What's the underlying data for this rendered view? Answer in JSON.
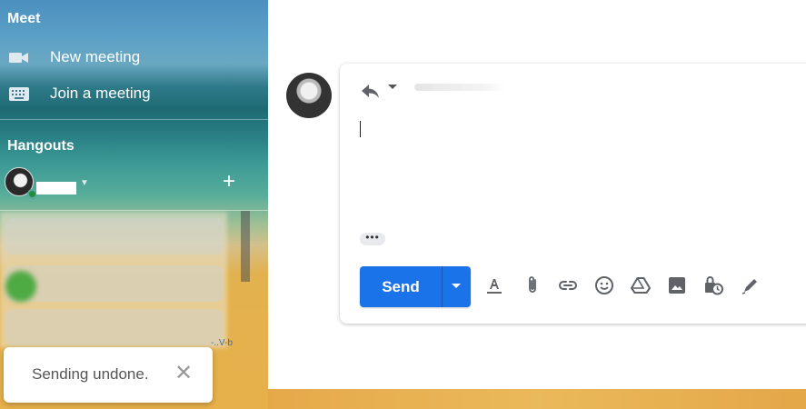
{
  "sidebar": {
    "meet": {
      "title": "Meet",
      "items": [
        {
          "label": "New meeting",
          "icon": "videocam-icon"
        },
        {
          "label": "Join a meeting",
          "icon": "keyboard-icon"
        }
      ]
    },
    "hangouts": {
      "title": "Hangouts"
    },
    "partial_text": "-..V-b"
  },
  "toast": {
    "message": "Sending undone.",
    "close_icon": "close-icon"
  },
  "compose": {
    "reply_icon": "reply-icon",
    "more_label": "•••",
    "send_label": "Send",
    "toolbar": [
      "format-text-icon",
      "attach-icon",
      "link-icon",
      "emoji-icon",
      "drive-icon",
      "photo-icon",
      "confidential-mode-icon",
      "signature-pen-icon"
    ]
  },
  "colors": {
    "send_blue": "#1a73e8",
    "presence_green": "#1e8e3e"
  }
}
